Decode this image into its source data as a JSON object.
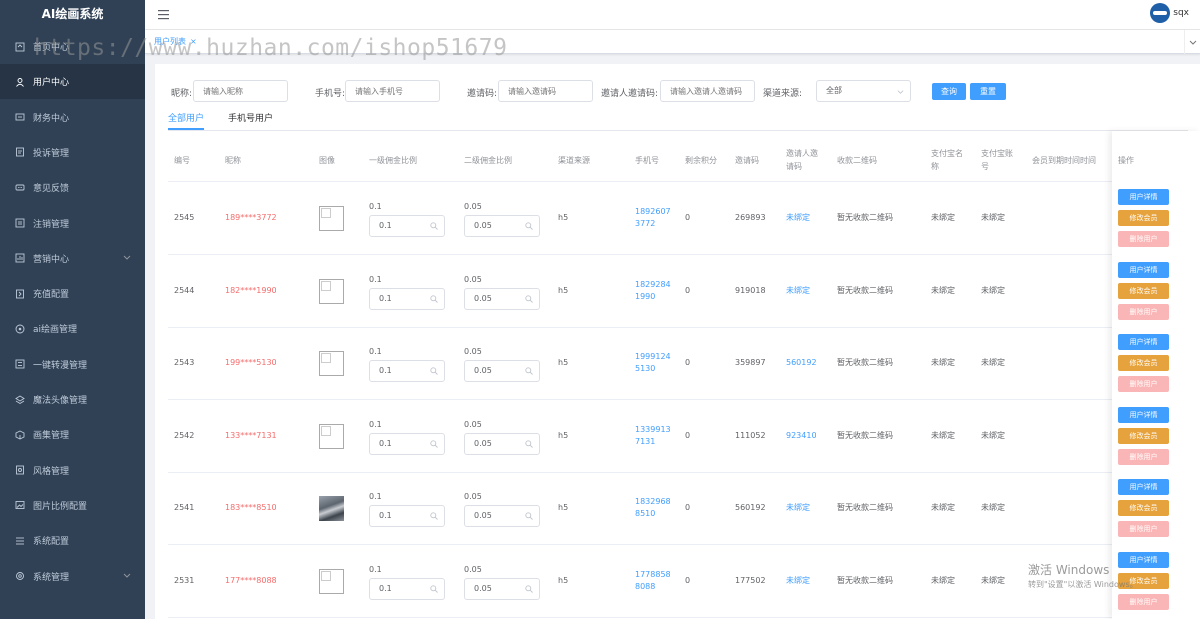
{
  "app": {
    "title": "AI绘画系统"
  },
  "user": {
    "name": "sqx"
  },
  "tags": {
    "current": "用户列表",
    "close": "×"
  },
  "watermark": "https://www.huzhan.com/ishop51679",
  "sidebar": {
    "items": [
      {
        "label": "首页中心",
        "icon": "home-icon"
      },
      {
        "label": "用户中心",
        "icon": "user-icon",
        "active": true
      },
      {
        "label": "财务中心",
        "icon": "wallet-icon"
      },
      {
        "label": "投诉管理",
        "icon": "complaint-icon"
      },
      {
        "label": "意见反馈",
        "icon": "feedback-icon"
      },
      {
        "label": "注销管理",
        "icon": "logout-icon"
      },
      {
        "label": "营销中心",
        "icon": "marketing-icon",
        "expandable": true
      },
      {
        "label": "充值配置",
        "icon": "recharge-icon"
      },
      {
        "label": "ai绘画管理",
        "icon": "paint-icon"
      },
      {
        "label": "一键转漫管理",
        "icon": "convert-icon"
      },
      {
        "label": "魔法头像管理",
        "icon": "layers-icon"
      },
      {
        "label": "画集管理",
        "icon": "box-icon"
      },
      {
        "label": "风格管理",
        "icon": "style-icon"
      },
      {
        "label": "图片比例配置",
        "icon": "image-ratio-icon"
      },
      {
        "label": "系统配置",
        "icon": "list-icon"
      },
      {
        "label": "系统管理",
        "icon": "settings-icon",
        "expandable": true
      }
    ]
  },
  "filters": {
    "nickname": {
      "label": "昵称:",
      "placeholder": "请输入昵称"
    },
    "phone": {
      "label": "手机号:",
      "placeholder": "请输入手机号"
    },
    "invite_code": {
      "label": "邀请码:",
      "placeholder": "请输入邀请码"
    },
    "inviter_code": {
      "label": "邀请人邀请码:",
      "placeholder": "请输入邀请人邀请码"
    },
    "channel": {
      "label": "渠道来源:",
      "value": "全部"
    },
    "search_button": "查询",
    "reset_button": "重置"
  },
  "tabs": [
    {
      "label": "全部用户",
      "active": true
    },
    {
      "label": "手机号用户"
    }
  ],
  "table": {
    "headers": {
      "id": "编号",
      "nickname": "昵称",
      "avatar": "图像",
      "rate1": "一级佣金比例",
      "rate2": "二级佣金比例",
      "channel": "渠道来源",
      "phone": "手机号",
      "points": "剩余积分",
      "invite_code": "邀请码",
      "inviter_code": "邀请人邀请码",
      "qrcode": "收款二维码",
      "alipay_name": "支付宝名称",
      "alipay_account": "支付宝账号",
      "vip_expire": "会员到期时间时间",
      "actions": "操作"
    },
    "rows": [
      {
        "id": "2545",
        "nickname": "189****3772",
        "avatar": "empty",
        "rate1": "0.1",
        "rate2": "0.05",
        "channel": "h5",
        "phone": "18926073772",
        "points": "0",
        "invite_code": "269893",
        "inviter_code": "未绑定",
        "qrcode": "暂无收款二维码",
        "alipay_name": "未绑定",
        "alipay_account": "未绑定",
        "vip_expire": ""
      },
      {
        "id": "2544",
        "nickname": "182****1990",
        "avatar": "empty",
        "rate1": "0.1",
        "rate2": "0.05",
        "channel": "h5",
        "phone": "18292841990",
        "points": "0",
        "invite_code": "919018",
        "inviter_code": "未绑定",
        "qrcode": "暂无收款二维码",
        "alipay_name": "未绑定",
        "alipay_account": "未绑定",
        "vip_expire": ""
      },
      {
        "id": "2543",
        "nickname": "199****5130",
        "avatar": "empty",
        "rate1": "0.1",
        "rate2": "0.05",
        "channel": "h5",
        "phone": "19991245130",
        "points": "0",
        "invite_code": "359897",
        "inviter_code": "560192",
        "qrcode": "暂无收款二维码",
        "alipay_name": "未绑定",
        "alipay_account": "未绑定",
        "vip_expire": ""
      },
      {
        "id": "2542",
        "nickname": "133****7131",
        "avatar": "empty",
        "rate1": "0.1",
        "rate2": "0.05",
        "channel": "h5",
        "phone": "13399137131",
        "points": "0",
        "invite_code": "111052",
        "inviter_code": "923410",
        "qrcode": "暂无收款二维码",
        "alipay_name": "未绑定",
        "alipay_account": "未绑定",
        "vip_expire": ""
      },
      {
        "id": "2541",
        "nickname": "183****8510",
        "avatar": "photo",
        "rate1": "0.1",
        "rate2": "0.05",
        "channel": "h5",
        "phone": "18329688510",
        "points": "0",
        "invite_code": "560192",
        "inviter_code": "未绑定",
        "qrcode": "暂无收款二维码",
        "alipay_name": "未绑定",
        "alipay_account": "未绑定",
        "vip_expire": ""
      },
      {
        "id": "2531",
        "nickname": "177****8088",
        "avatar": "empty",
        "rate1": "0.1",
        "rate2": "0.05",
        "channel": "h5",
        "phone": "17788588088",
        "points": "0",
        "invite_code": "177502",
        "inviter_code": "未绑定",
        "qrcode": "暂无收款二维码",
        "alipay_name": "未绑定",
        "alipay_account": "未绑定",
        "vip_expire": ""
      }
    ],
    "action_labels": {
      "detail": "用户详情",
      "member": "修改会员",
      "delete": "删除用户"
    }
  },
  "os_watermark": {
    "line1": "激活 Windows",
    "line2": "转到\"设置\"以激活 Windows。"
  },
  "colors": {
    "sidebar": "#304156",
    "primary": "#409eff",
    "warning": "#e6a23c",
    "danger_light": "#fab6b6",
    "nickname": "#f56c6c"
  }
}
